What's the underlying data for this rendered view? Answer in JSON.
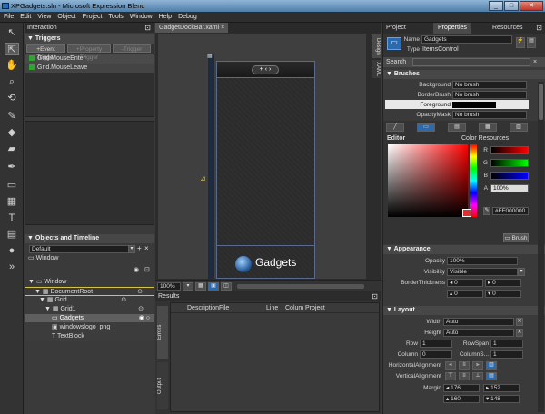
{
  "window": {
    "title": "XPGadgets.sln - Microsoft Expression Blend",
    "buttons": [
      "_",
      "□",
      "✕"
    ]
  },
  "menu": [
    "File",
    "Edit",
    "View",
    "Object",
    "Project",
    "Tools",
    "Window",
    "Help",
    "Debug"
  ],
  "interaction": {
    "title": "Interaction",
    "triggers_header": "Triggers",
    "trigger_buttons": [
      "+Event Trigger",
      "+Property Trigger",
      "-Trigger"
    ],
    "triggers": [
      "Grid.MouseEnter",
      "Grid.MouseLeave"
    ]
  },
  "objects": {
    "header": "Objects and Timeline",
    "timeline": "Default",
    "scope": "Window",
    "tree": [
      "Window",
      "DocumentRoot",
      "Grid",
      "Grid1",
      "Gadgets",
      "windowslogo_png",
      "TextBlock"
    ]
  },
  "doc": {
    "tab": "GadgetDockBar.xaml",
    "canvas_text": "Gadgets",
    "zoom": "100%",
    "side_tabs": [
      "Design",
      "XAML"
    ]
  },
  "results": {
    "title": "Results",
    "columns": [
      "Description",
      "File",
      "Line",
      "Colum",
      "Project"
    ],
    "side_tabs": [
      "Errors",
      "Output"
    ]
  },
  "right": {
    "tabs": [
      "Project",
      "Properties",
      "Resources"
    ],
    "name_label": "Name",
    "name_value": "Gadgets",
    "type_label": "Type",
    "type_value": "ItemsControl",
    "search_label": "Search",
    "brushes": {
      "header": "Brushes",
      "rows": [
        [
          "Background",
          "No brush"
        ],
        [
          "BorderBrush",
          "No brush"
        ],
        [
          "Foreground",
          ""
        ],
        [
          "OpacityMask",
          "No brush"
        ]
      ],
      "editor": "Editor",
      "color_resources": "Color Resources",
      "r": "R",
      "g": "G",
      "b": "B",
      "a": "A",
      "a_value": "100%",
      "hex": "#FF000000",
      "brush_btn": "Brush"
    },
    "appearance": {
      "header": "Appearance",
      "opacity_label": "Opacity",
      "opacity": "100%",
      "visibility_label": "Visibility",
      "visibility": "Visible",
      "border_label": "BorderThickness",
      "border": [
        "0",
        "0",
        "0",
        "0"
      ]
    },
    "layout": {
      "header": "Layout",
      "width_label": "Width",
      "width": "Auto",
      "height_label": "Height",
      "height": "Auto",
      "row_label": "Row",
      "row": "1",
      "rowspan_label": "RowSpan",
      "rowspan": "1",
      "column_label": "Column",
      "column": "0",
      "colspan_label": "ColumnS...",
      "colspan": "1",
      "halign_label": "HorizontalAlignment",
      "valign_label": "VerticalAlignment",
      "margin_label": "Margin",
      "margin": [
        "176",
        "152",
        "160",
        "148"
      ]
    }
  },
  "colors": {
    "accent": "#2a6ab0",
    "selection": "#5f5f5f",
    "panel": "#3a3a3a"
  }
}
